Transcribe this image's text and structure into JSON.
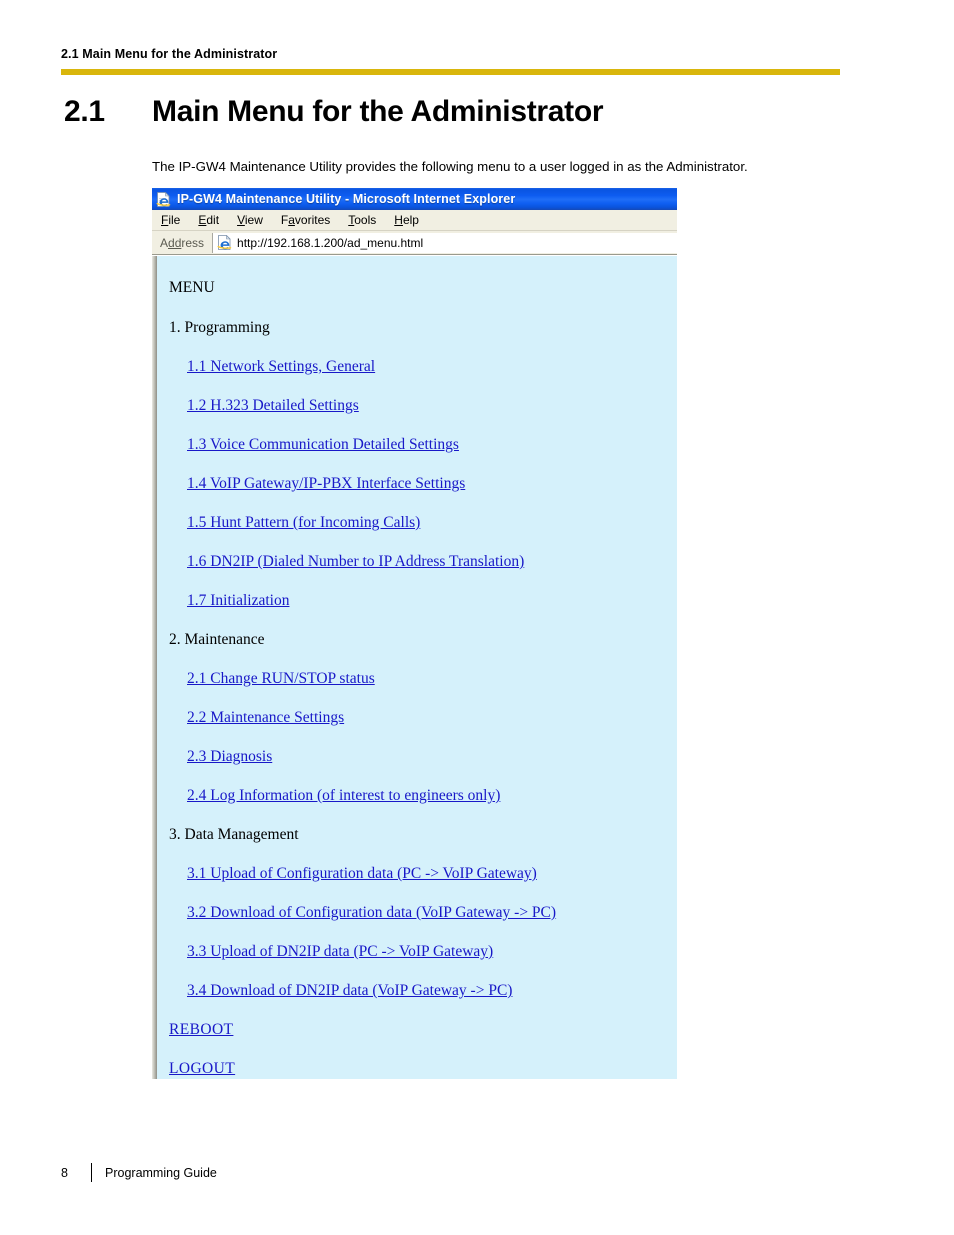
{
  "running_header": {
    "text": "2.1 Main Menu for the Administrator"
  },
  "section": {
    "number": "2.1",
    "heading": "Main Menu for the Administrator",
    "intro": "The IP-GW4 Maintenance Utility provides the following menu to a user logged in as the Administrator."
  },
  "browser": {
    "title": "IP-GW4 Maintenance Utility - Microsoft Internet Explorer",
    "icon": "ie-document-icon",
    "menubar": [
      {
        "accel": "F",
        "rest": "ile"
      },
      {
        "accel": "E",
        "rest": "dit"
      },
      {
        "accel": "V",
        "rest": "iew"
      },
      {
        "pre": "F",
        "accel": "a",
        "rest": "vorites"
      },
      {
        "accel": "T",
        "rest": "ools"
      },
      {
        "accel": "H",
        "rest": "elp"
      }
    ],
    "address_label_pre": "A",
    "address_label_accel": "dd",
    "address_label_rest": "ress",
    "address_url": "http://192.168.1.200/ad_menu.html"
  },
  "page": {
    "menu_title": "MENU",
    "sections": [
      {
        "group": "1. Programming",
        "links": [
          "1.1 Network Settings, General",
          "1.2 H.323 Detailed Settings",
          "1.3 Voice Communication Detailed Settings",
          "1.4 VoIP Gateway/IP-PBX Interface Settings",
          "1.5 Hunt Pattern (for Incoming Calls)",
          "1.6 DN2IP (Dialed Number to IP Address Translation)",
          "1.7 Initialization"
        ]
      },
      {
        "group": "2. Maintenance",
        "links": [
          "2.1 Change RUN/STOP status",
          "2.2 Maintenance Settings",
          "2.3 Diagnosis",
          "2.4 Log Information (of interest to engineers only)"
        ]
      },
      {
        "group": "3. Data Management",
        "links": [
          "3.1 Upload of Configuration data (PC -> VoIP Gateway)",
          "3.2 Download of Configuration data (VoIP Gateway -> PC)",
          "3.3 Upload of DN2IP data (PC -> VoIP Gateway)",
          "3.4 Download of DN2IP data (VoIP Gateway -> PC)"
        ]
      }
    ],
    "actions": [
      "REBOOT",
      "LOGOUT"
    ]
  },
  "footer": {
    "page_number": "8",
    "guide_title": "Programming Guide"
  },
  "colors": {
    "header_rule": "#d9b60c",
    "titlebar_blue": "#0d5cf0",
    "viewport_bg": "#d5f1fb",
    "link_blue": "#1818c8",
    "chrome_bg": "#f1efe2"
  }
}
